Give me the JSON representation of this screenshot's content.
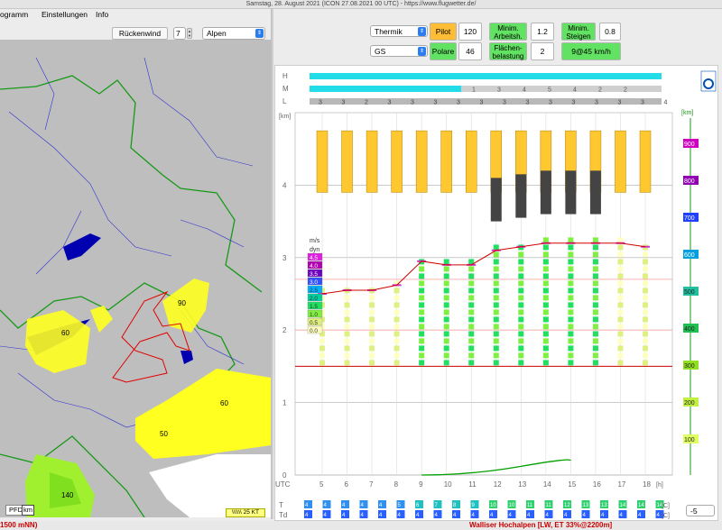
{
  "window": {
    "title": "Samstag, 28. August 2021 (ICON 27.08.2021 00 UTC) - https://www.flugwetter.de/"
  },
  "menu": {
    "items": [
      "ogramm",
      "Einstellungen",
      "Info"
    ]
  },
  "left_controls": {
    "rueckenwind_label": "Rückenwind",
    "rueckenwind_value": "7",
    "region_select": "Alpen"
  },
  "map": {
    "labels": [
      "60",
      "90",
      "60",
      "50",
      "140"
    ],
    "pfd_label": "PFD",
    "km_label": "km",
    "legend_label": "\\\\\\\\\\\\ 25 KT"
  },
  "right_controls": {
    "mode_select": "Thermik",
    "glider_select": "GS",
    "pilot_label": "Pilot",
    "pilot_value": "120",
    "polare_label": "Polare",
    "polare_value": "46",
    "min_arbeitsh_label": "Minim. Arbeitsh.",
    "min_arbeitsh_value": "1.2",
    "flaechen_label": "Flächen-belastung",
    "flaechen_value": "2",
    "min_steigen_label": "Minim. Steigen",
    "min_steigen_value": "0.8",
    "speed_value": "9@45 km/h",
    "offset_value": "-5"
  },
  "status_bar": {
    "left_text": "1500 mNN)",
    "right_text": "Walliser Hochalpen [LW, ET  33%@2200m]"
  },
  "chart_data": {
    "type": "heatmap",
    "row_labels_top": [
      "H",
      "M",
      "L"
    ],
    "cloud_M_values": [
      "1",
      "3",
      "4",
      "5",
      "4",
      "2",
      "2"
    ],
    "cloud_L_values": [
      "3",
      "3",
      "2",
      "3",
      "3",
      "3",
      "3",
      "3",
      "3",
      "3",
      "3",
      "3",
      "3",
      "3",
      "3",
      "4"
    ],
    "left_axis_unit": "[km]",
    "left_axis_ticks": [
      "0",
      "1",
      "2",
      "3",
      "4"
    ],
    "right_axis_unit": "[km]",
    "right_axis_ticks": [
      "100",
      "200",
      "300",
      "400",
      "500",
      "600",
      "700",
      "800",
      "900"
    ],
    "x_label": "UTC",
    "x_unit": "[h]",
    "x_ticks": [
      "5",
      "6",
      "7",
      "8",
      "9",
      "10",
      "11",
      "12",
      "13",
      "14",
      "15",
      "16",
      "17",
      "18"
    ],
    "climb_legend_unit": "m/s",
    "climb_legend_sub": "dyn",
    "climb_legend": [
      "4.5",
      "4.0",
      "3.5",
      "3.0",
      "2.5",
      "2.0",
      "1.5",
      "1.0",
      "0.5",
      "0.0"
    ],
    "climb_colors": [
      "#e020e0",
      "#b000b0",
      "#7000c0",
      "#3050ff",
      "#00b0ff",
      "#00d0a0",
      "#20e060",
      "#80f040",
      "#e0f080",
      "#ffffc0"
    ],
    "thermal_tops_km": [
      2.5,
      2.55,
      2.55,
      2.62,
      2.95,
      2.9,
      2.9,
      3.1,
      3.15,
      3.2,
      3.2,
      3.2,
      3.2,
      3.15
    ],
    "cloud_base_km": [
      null,
      null,
      null,
      null,
      null,
      null,
      null,
      3.5,
      3.55,
      3.6,
      3.6,
      3.6,
      null,
      null
    ],
    "bottom_T_label": "T",
    "bottom_Td_label": "Td",
    "bottom_unit_T": "[C]",
    "bottom_unit_Td": "[C]",
    "T_values": [
      "4",
      "4",
      "4",
      "4",
      "4",
      "5",
      "6",
      "7",
      "8",
      "9",
      "10",
      "10",
      "11",
      "11",
      "12",
      "13",
      "13",
      "14",
      "14",
      "14"
    ],
    "Td_values": [
      "4",
      "4",
      "4",
      "4",
      "4",
      "4",
      "4",
      "4",
      "4",
      "4",
      "4",
      "4",
      "4",
      "4",
      "4",
      "4",
      "4",
      "4",
      "4",
      "4"
    ]
  }
}
